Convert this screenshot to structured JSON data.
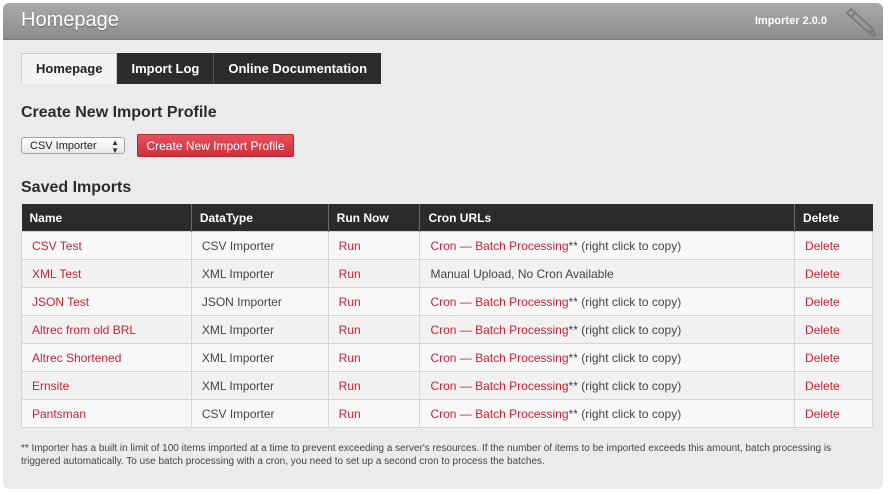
{
  "header": {
    "title": "Homepage",
    "version": "Importer 2.0.0"
  },
  "tabs": [
    {
      "label": "Homepage",
      "active": true
    },
    {
      "label": "Import Log",
      "active": false
    },
    {
      "label": "Online Documentation",
      "active": false
    }
  ],
  "create_section": {
    "heading": "Create New Import Profile",
    "select_value": "CSV Importer",
    "button_label": "Create New Import Profile"
  },
  "saved_section": {
    "heading": "Saved Imports",
    "columns": [
      "Name",
      "DataType",
      "Run Now",
      "Cron URLs",
      "Delete"
    ],
    "rows": [
      {
        "name": "CSV Test",
        "datatype": "CSV Importer",
        "run": "Run",
        "cron": "Cron",
        "sep": " — ",
        "batch": "Batch Processing",
        "note": "** (right click to copy)",
        "delete": "Delete"
      },
      {
        "name": "XML Test",
        "datatype": "XML Importer",
        "run": "Run",
        "cron_text": "Manual Upload, No Cron Available",
        "delete": "Delete"
      },
      {
        "name": "JSON Test",
        "datatype": "JSON Importer",
        "run": "Run",
        "cron": "Cron",
        "sep": " — ",
        "batch": "Batch Processing",
        "note": "** (right click to copy)",
        "delete": "Delete"
      },
      {
        "name": "Altrec from old BRL",
        "datatype": "XML Importer",
        "run": "Run",
        "cron": "Cron",
        "sep": " — ",
        "batch": "Batch Processing",
        "note": "** (right click to copy)",
        "delete": "Delete"
      },
      {
        "name": "Altrec Shortened",
        "datatype": "XML Importer",
        "run": "Run",
        "cron": "Cron",
        "sep": " — ",
        "batch": "Batch Processing",
        "note": "** (right click to copy)",
        "delete": "Delete"
      },
      {
        "name": "Ernsite",
        "datatype": "XML Importer",
        "run": "Run",
        "cron": "Cron",
        "sep": " — ",
        "batch": "Batch Processing",
        "note": "** (right click to copy)",
        "delete": "Delete"
      },
      {
        "name": "Pantsman",
        "datatype": "CSV Importer",
        "run": "Run",
        "cron": "Cron",
        "sep": " — ",
        "batch": "Batch Processing",
        "note": "** (right click to copy)",
        "delete": "Delete"
      }
    ]
  },
  "footnote": "** Importer has a built in limit of 100 items imported at a time to prevent exceeding a server's resources. If the number of items to be imported exceeds this amount, batch processing is triggered automatically. To use batch processing with a cron, you need to set up a second cron to process the batches.",
  "colors": {
    "accent": "#c82333",
    "header_dark": "#2b2b2b",
    "button": "#d83a48"
  }
}
